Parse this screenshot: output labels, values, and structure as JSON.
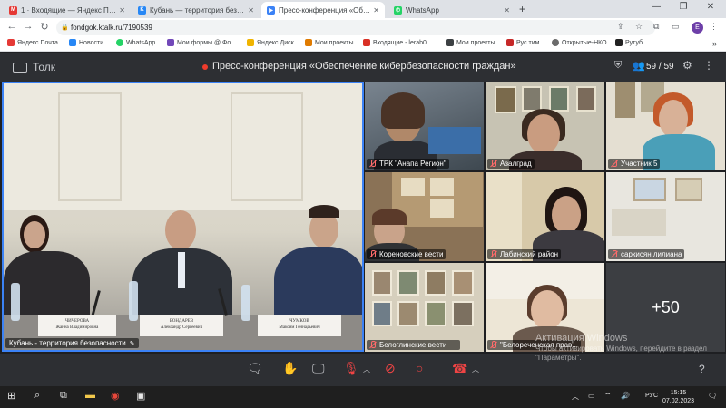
{
  "browser": {
    "tabs": [
      {
        "label": "1 · Входящие — Яндекс Почта",
        "icon": "yandex-mail-icon",
        "color": "#e53935"
      },
      {
        "label": "Кубань — территория безопасн",
        "icon": "vk-icon",
        "color": "#2787f5"
      },
      {
        "label": "Пресс-конференция «Обес",
        "icon": "video-icon",
        "color": "#3b82f6"
      },
      {
        "label": "WhatsApp",
        "icon": "whatsapp-icon",
        "color": "#25d366"
      }
    ],
    "url": "fondgok.ktalk.ru/7190539",
    "bookmarks": [
      {
        "label": "Яндекс.Почта",
        "color": "#e53935"
      },
      {
        "label": "Новости",
        "color": "#2787f5"
      },
      {
        "label": "WhatsApp",
        "color": "#25d366"
      },
      {
        "label": "Мои формы @ Фо...",
        "color": "#7248b9"
      },
      {
        "label": "Яндекс.Диск",
        "color": "#f0b400"
      },
      {
        "label": "Мои проекты",
        "color": "#e07b00"
      },
      {
        "label": "Входящие - lerab0...",
        "color": "#d93025"
      },
      {
        "label": "Мои проекты",
        "color": "#3c4043"
      },
      {
        "label": "Рус тим",
        "color": "#c62828"
      },
      {
        "label": "Открытые-НКО",
        "color": "#6b6b6b"
      },
      {
        "label": "Рутуб",
        "color": "#222222"
      }
    ],
    "profile_initial": "E"
  },
  "app": {
    "name": "Толк",
    "conference_title": "Пресс-конференция «Обеспечение кибербезопасности граждан»",
    "participant_count": "59 / 59"
  },
  "main_video": {
    "caption": "Кубань - территория безопасности",
    "nameplates": [
      "ЧИЧЕРОВА\nЖанна Владимировна",
      "БОНДАРЕВ\nАлександр Сергеевич",
      "ЧУМКОВ\nМаксим Геннадьевич"
    ]
  },
  "tiles": [
    {
      "caption": "ТРК \"Анапа Регион\""
    },
    {
      "caption": "Азалград"
    },
    {
      "caption": "Участник 5"
    },
    {
      "caption": "Кореновские вести"
    },
    {
      "caption": "Лабинский район"
    },
    {
      "caption": "саркисян лилиана"
    },
    {
      "caption": "Белоглинские вести"
    },
    {
      "caption": "\"Белореченская прав..."
    }
  ],
  "more_participants": "+50",
  "watermark": {
    "title": "Активация Windows",
    "subtitle": "Чтобы активировать Windows, перейдите в раздел \"Параметры\"."
  },
  "taskbar": {
    "lang": "РУС",
    "time": "15:15",
    "date": "07.02.2023"
  },
  "colors": {
    "active_speaker_border": "#3b82f6",
    "record_dot": "#ef3b2c",
    "muted": "#ef4444"
  }
}
